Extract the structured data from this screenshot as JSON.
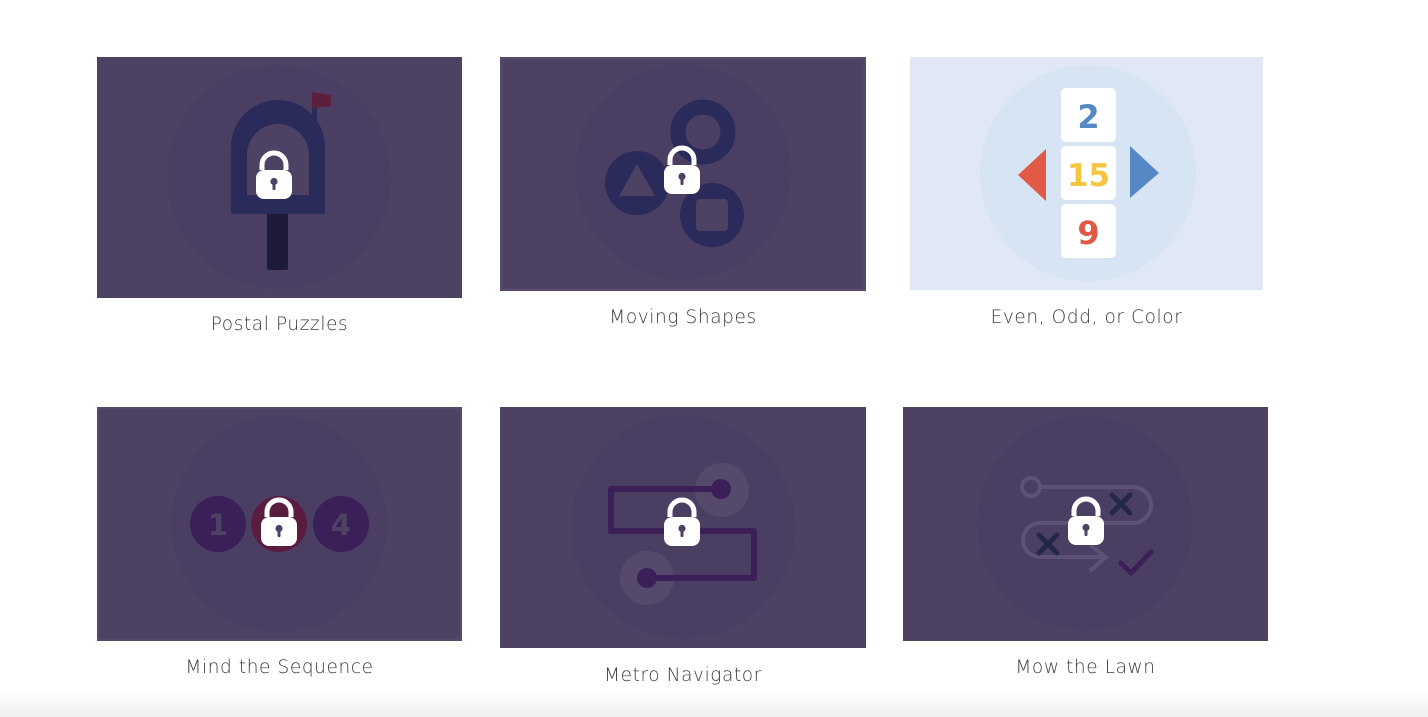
{
  "games": [
    {
      "title": "Postal Puzzles",
      "locked": true,
      "icon": "mailbox-icon"
    },
    {
      "title": "Moving Shapes",
      "locked": true,
      "icon": "shapes-icon"
    },
    {
      "title": "Even, Odd, or Color",
      "locked": false,
      "icon": "number-tiles-icon",
      "numbers": [
        "2",
        "15",
        "9"
      ]
    },
    {
      "title": "Mind the Sequence",
      "locked": true,
      "icon": "sequence-icon",
      "numbers": [
        "1",
        "4"
      ]
    },
    {
      "title": "Metro Navigator",
      "locked": true,
      "icon": "metro-route-icon"
    },
    {
      "title": "Mow the Lawn",
      "locked": true,
      "icon": "lawn-path-icon"
    }
  ],
  "colors": {
    "locked_bg": "#4d4264",
    "locked_circle": "#4a3f62",
    "navy": "#2a2b5a",
    "plum": "#3b1f58",
    "unlocked_bg": "#dfe8f4",
    "unlocked_circle": "#d6e4f3",
    "red": "#e05a45",
    "blue": "#5588c4",
    "yellow": "#f3c540"
  }
}
